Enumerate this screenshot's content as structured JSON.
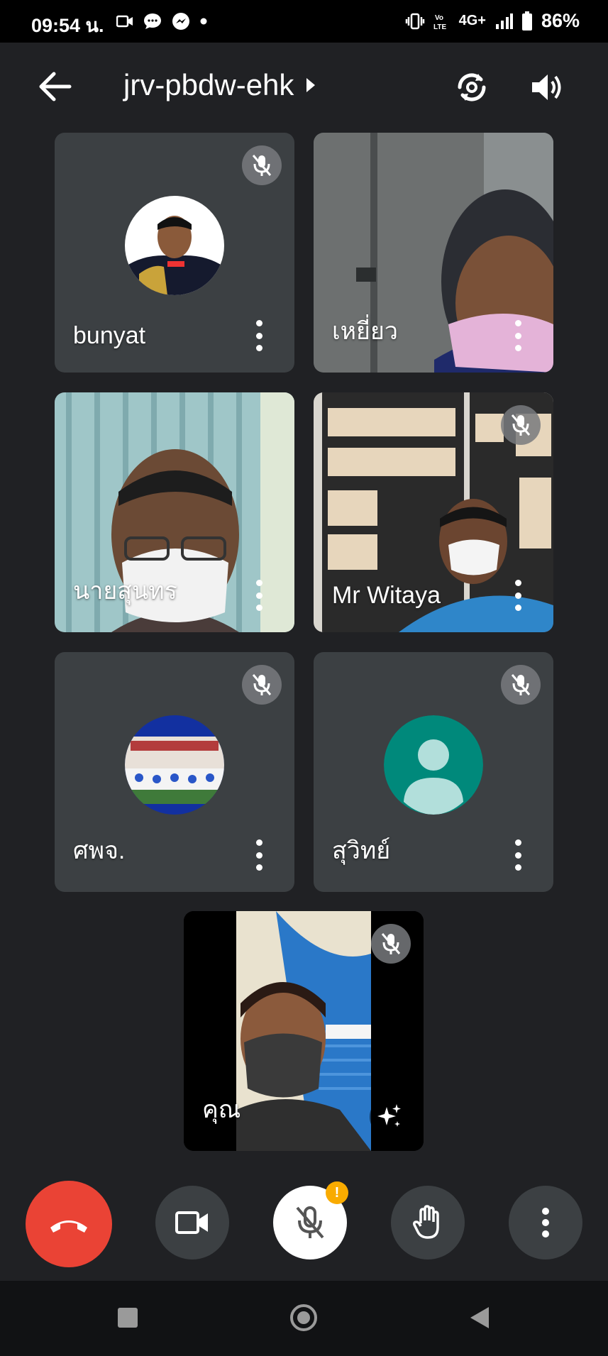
{
  "status_bar": {
    "time": "09:54 น.",
    "network": "4G+",
    "battery": "86%"
  },
  "header": {
    "meeting_code": "jrv-pbdw-ehk"
  },
  "participants": [
    {
      "name": "bunyat",
      "muted": true
    },
    {
      "name": "เหยี่ยว",
      "muted": false
    },
    {
      "name": "นายสุนทร",
      "muted": false
    },
    {
      "name": "Mr Witaya",
      "muted": true
    },
    {
      "name": "ศพจ.",
      "muted": true
    },
    {
      "name": "สุวิทย์",
      "muted": true
    },
    {
      "name": "คุณ",
      "muted": true
    }
  ],
  "controls": {
    "mic_warning": "!"
  },
  "colors": {
    "background": "#202124",
    "tile": "#3c4043",
    "end_call": "#ea4335",
    "avatar_teal": "#00897b",
    "warning": "#f9ab00"
  }
}
